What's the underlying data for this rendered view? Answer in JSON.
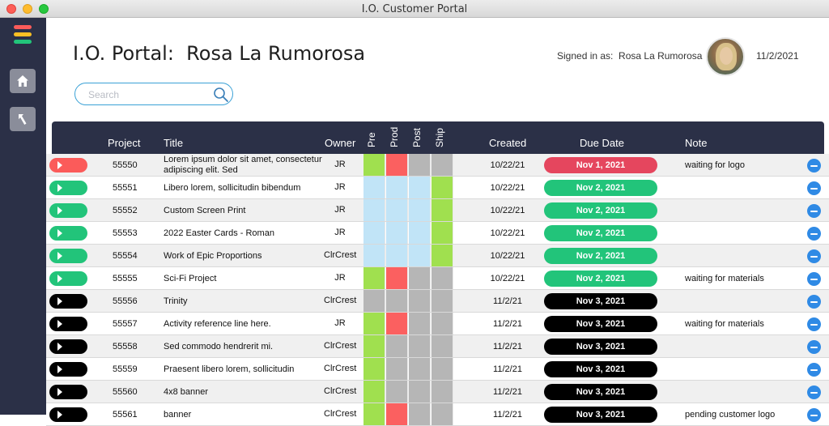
{
  "window": {
    "title": "I.O. Customer Portal"
  },
  "header": {
    "title": "I.O. Portal:  Rosa La Rumorosa",
    "signed_in": "Signed in as:  Rosa La Rumorosa",
    "date": "11/2/2021"
  },
  "search": {
    "placeholder": "Search",
    "value": ""
  },
  "colors": {
    "sidebar": "#2b3047",
    "status_red": "#fb5b5a",
    "status_green": "#22c47a",
    "status_black": "#000000",
    "due_red": "#e5465e",
    "due_green": "#22c47a",
    "due_black": "#000000",
    "stage_green": "#a0e04f",
    "stage_red": "#fb6060",
    "stage_blue": "#c1e4f7",
    "stage_gray": "#b6b6b6",
    "action_blue": "#2f8ae5"
  },
  "table": {
    "columns": {
      "project": "Project",
      "title": "Title",
      "owner": "Owner",
      "pre": "Pre",
      "prod": "Prod",
      "post": "Post",
      "ship": "Ship",
      "created": "Created",
      "due": "Due Date",
      "note": "Note"
    },
    "rows": [
      {
        "status": "red",
        "project": "55550",
        "title": "Lorem ipsum dolor sit amet, consectetur adipiscing elit. Sed",
        "owner": "JR",
        "stages": [
          "green",
          "red",
          "gray",
          "gray"
        ],
        "created": "10/22/21",
        "due": "Nov 1, 2021",
        "due_color": "red",
        "note": "waiting for logo"
      },
      {
        "status": "green",
        "project": "55551",
        "title": "Libero lorem, sollicitudin bibendum",
        "owner": "JR",
        "stages": [
          "blue",
          "blue",
          "blue",
          "green"
        ],
        "created": "10/22/21",
        "due": "Nov 2, 2021",
        "due_color": "green",
        "note": ""
      },
      {
        "status": "green",
        "project": "55552",
        "title": "Custom Screen Print",
        "owner": "JR",
        "stages": [
          "blue",
          "blue",
          "blue",
          "green"
        ],
        "created": "10/22/21",
        "due": "Nov 2, 2021",
        "due_color": "green",
        "note": ""
      },
      {
        "status": "green",
        "project": "55553",
        "title": "2022 Easter Cards - Roman",
        "owner": "JR",
        "stages": [
          "blue",
          "blue",
          "blue",
          "green"
        ],
        "created": "10/22/21",
        "due": "Nov 2, 2021",
        "due_color": "green",
        "note": ""
      },
      {
        "status": "green",
        "project": "55554",
        "title": "Work of Epic Proportions",
        "owner": "ClrCrest",
        "stages": [
          "blue",
          "blue",
          "blue",
          "green"
        ],
        "created": "10/22/21",
        "due": "Nov 2, 2021",
        "due_color": "green",
        "note": ""
      },
      {
        "status": "green",
        "project": "55555",
        "title": "Sci-Fi Project",
        "owner": "JR",
        "stages": [
          "green",
          "red",
          "gray",
          "gray"
        ],
        "created": "10/22/21",
        "due": "Nov 2, 2021",
        "due_color": "green",
        "note": "waiting for materials"
      },
      {
        "status": "black",
        "project": "55556",
        "title": "Trinity",
        "owner": "ClrCrest",
        "stages": [
          "gray",
          "gray",
          "gray",
          "gray"
        ],
        "created": "11/2/21",
        "due": "Nov 3, 2021",
        "due_color": "black",
        "note": ""
      },
      {
        "status": "black",
        "project": "55557",
        "title": "Activity reference line here.",
        "owner": "JR",
        "stages": [
          "green",
          "red",
          "gray",
          "gray"
        ],
        "created": "11/2/21",
        "due": "Nov 3, 2021",
        "due_color": "black",
        "note": "waiting for materials"
      },
      {
        "status": "black",
        "project": "55558",
        "title": "Sed commodo hendrerit mi.",
        "owner": "ClrCrest",
        "stages": [
          "green",
          "gray",
          "gray",
          "gray"
        ],
        "created": "11/2/21",
        "due": "Nov 3, 2021",
        "due_color": "black",
        "note": ""
      },
      {
        "status": "black",
        "project": "55559",
        "title": "Praesent libero lorem, sollicitudin",
        "owner": "ClrCrest",
        "stages": [
          "green",
          "gray",
          "gray",
          "gray"
        ],
        "created": "11/2/21",
        "due": "Nov 3, 2021",
        "due_color": "black",
        "note": ""
      },
      {
        "status": "black",
        "project": "55560",
        "title": "4x8 banner",
        "owner": "ClrCrest",
        "stages": [
          "green",
          "gray",
          "gray",
          "gray"
        ],
        "created": "11/2/21",
        "due": "Nov 3, 2021",
        "due_color": "black",
        "note": ""
      },
      {
        "status": "black",
        "project": "55561",
        "title": "banner",
        "owner": "ClrCrest",
        "stages": [
          "green",
          "red",
          "gray",
          "gray"
        ],
        "created": "11/2/21",
        "due": "Nov 3, 2021",
        "due_color": "black",
        "note": "pending customer logo"
      }
    ]
  },
  "icons": {
    "menu": "hamburger-menu-icon",
    "home": "home-icon",
    "back": "back-arrow-icon",
    "search": "search-icon",
    "play": "play-icon",
    "remove": "minus-circle-icon"
  }
}
